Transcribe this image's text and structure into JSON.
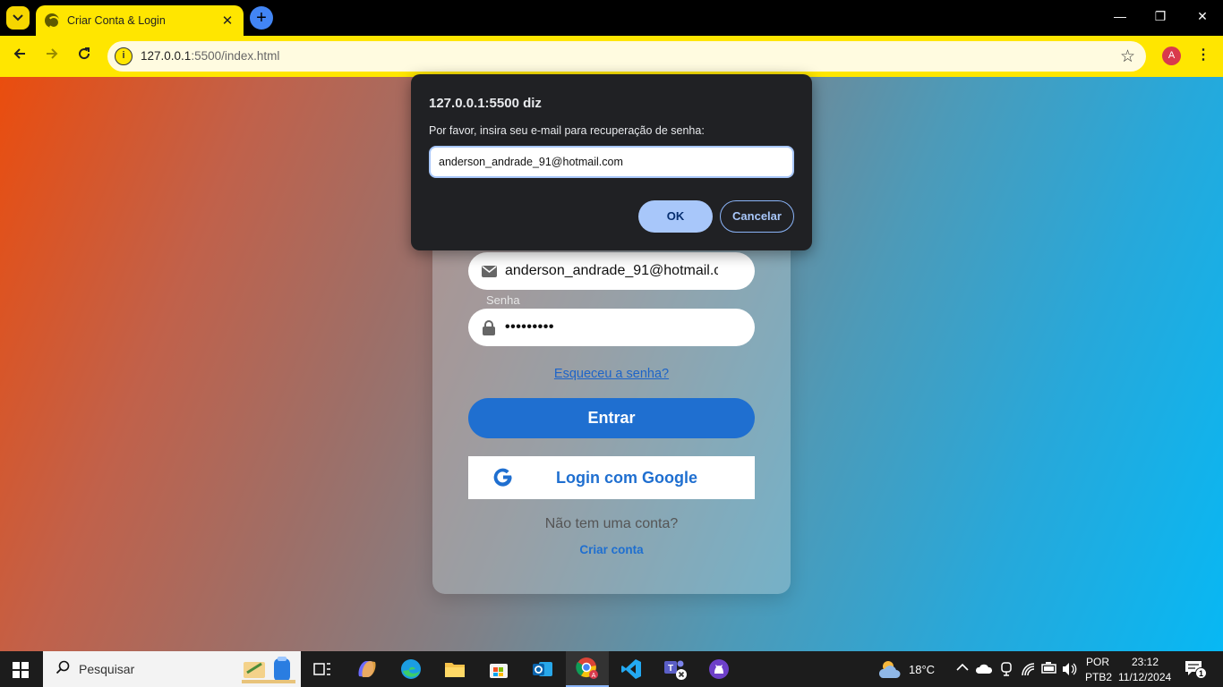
{
  "browser": {
    "tab_title": "Criar Conta & Login",
    "url_host": "127.0.0.1",
    "url_rest": ":5500/index.html",
    "profile_initial": "A"
  },
  "form": {
    "email_value": "anderson_andrade_91@hotmail.com",
    "password_label": "Senha",
    "password_value": "•••••••••",
    "forgot_link": "Esqueceu a senha?",
    "login_button": "Entrar",
    "google_button": "Login com Google",
    "no_account_text": "Não tem uma conta?",
    "create_account_link": "Criar conta"
  },
  "dialog": {
    "title": "127.0.0.1:5500 diz",
    "message": "Por favor, insira seu e-mail para recuperação de senha:",
    "input_value": "anderson_andrade_91@hotmail.com",
    "ok_label": "OK",
    "cancel_label": "Cancelar"
  },
  "taskbar": {
    "search_placeholder": "Pesquisar",
    "weather": "18°C",
    "language": "POR",
    "keyboard": "PTB2",
    "time": "23:12",
    "date": "11/12/2024",
    "notification_count": "1"
  },
  "colors": {
    "chrome_theme": "#ffe600",
    "primary_button": "#1f6fd0",
    "dialog_background": "#202124"
  }
}
